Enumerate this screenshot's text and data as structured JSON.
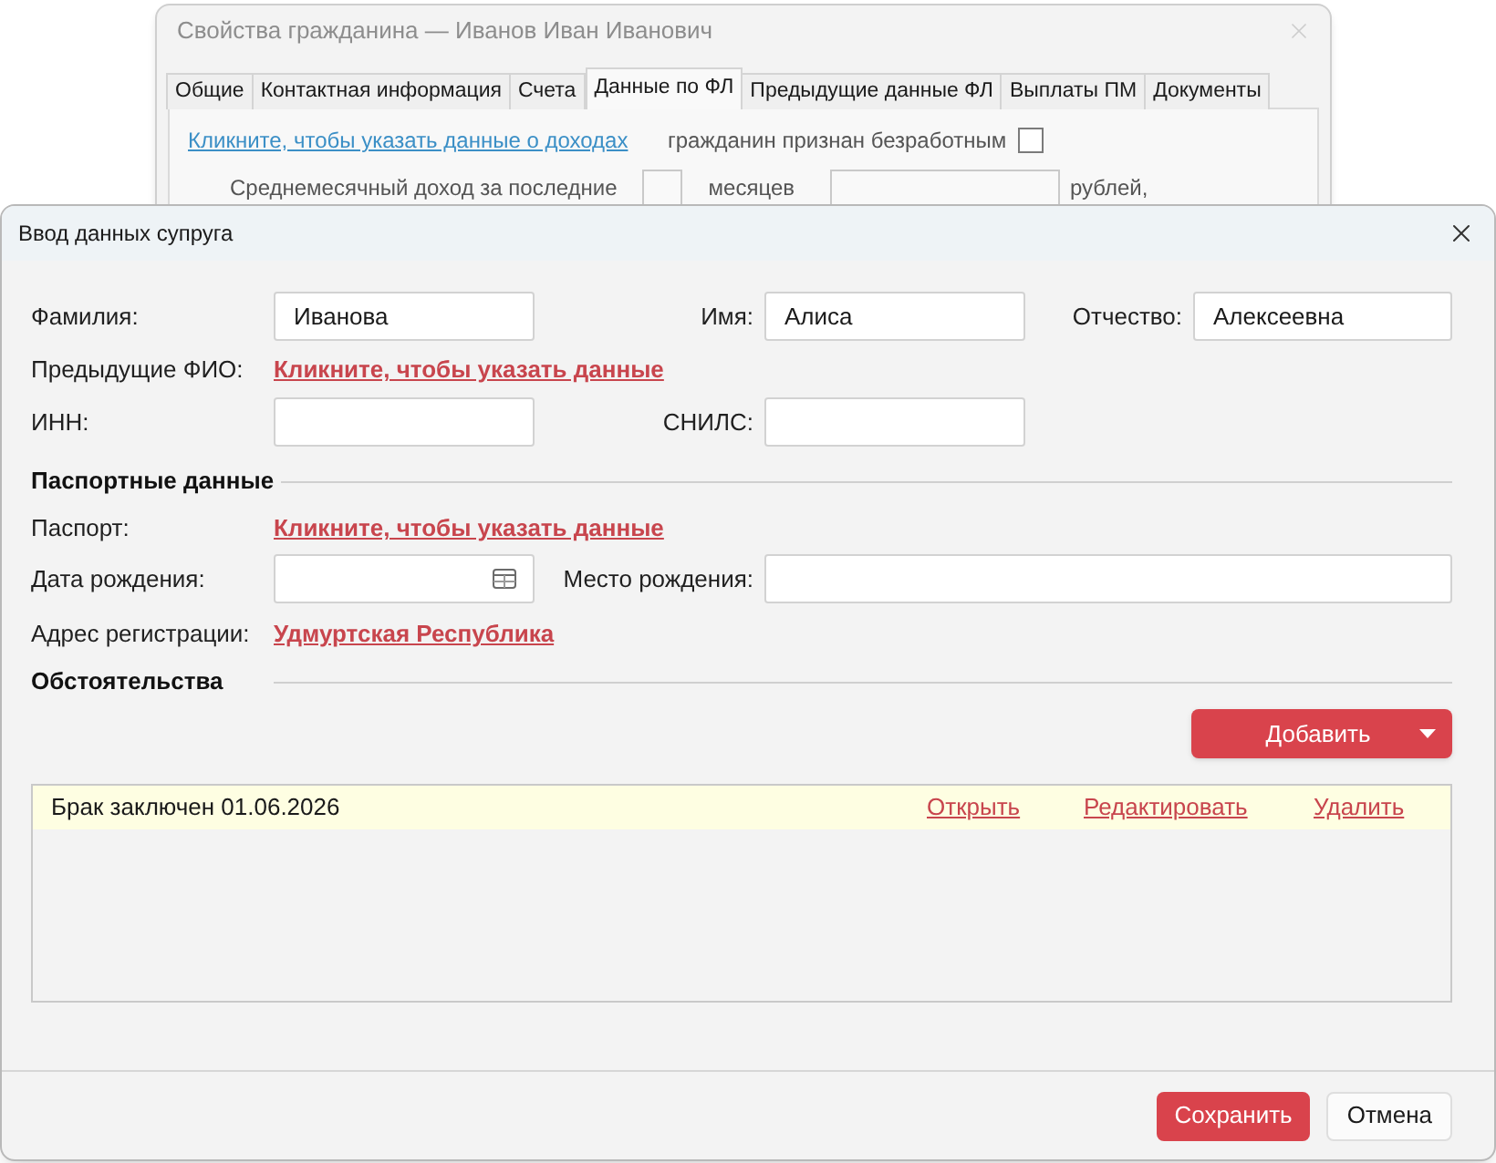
{
  "parent_window": {
    "title": "Свойства гражданина — Иванов Иван Иванович",
    "tabs": [
      {
        "label": "Общие",
        "selected": false
      },
      {
        "label": "Контактная информация",
        "selected": false
      },
      {
        "label": "Счета",
        "selected": false
      },
      {
        "label": "Данные по ФЛ",
        "selected": true
      },
      {
        "label": "Предыдущие данные ФЛ",
        "selected": false
      },
      {
        "label": "Выплаты ПМ",
        "selected": false
      },
      {
        "label": "Документы",
        "selected": false
      }
    ],
    "income_link": "Кликните, чтобы указать данные о доходах",
    "unemployed": {
      "label": "гражданин признан безработным",
      "checked": false
    },
    "average_income": {
      "label": "Среднемесячный доход за последние",
      "months_unit": "месяцев",
      "currency_unit": "рублей,"
    }
  },
  "dialog": {
    "title": "Ввод данных супруга",
    "surname": {
      "label": "Фамилия:",
      "value": "Иванова"
    },
    "first_name": {
      "label": "Имя:",
      "value": "Алиса"
    },
    "patronymic": {
      "label": "Отчество:",
      "value": "Алексеевна"
    },
    "previous_names": {
      "label": "Предыдущие ФИО:",
      "link": "Кликните, чтобы указать данные"
    },
    "inn": {
      "label": "ИНН:"
    },
    "snils": {
      "label": "СНИЛС:"
    },
    "passport_section": {
      "title": "Паспортные данные"
    },
    "passport": {
      "label": "Паспорт:",
      "link": "Кликните, чтобы указать данные"
    },
    "birth_date": {
      "label": "Дата рождения:"
    },
    "birth_place": {
      "label": "Место рождения:"
    },
    "registration_address": {
      "label": "Адрес регистрации:",
      "link": "Удмуртская Республика"
    },
    "circumstances": {
      "title": "Обстоятельства",
      "add_button": "Добавить",
      "items": [
        {
          "text": "Брак заключен 01.06.2026",
          "selected": true,
          "actions": [
            "Открыть",
            "Редактировать",
            "Удалить"
          ]
        }
      ]
    },
    "buttons": [
      {
        "label": "Сохранить",
        "kind": "primary"
      },
      {
        "label": "Отмена",
        "kind": "secondary"
      }
    ]
  }
}
